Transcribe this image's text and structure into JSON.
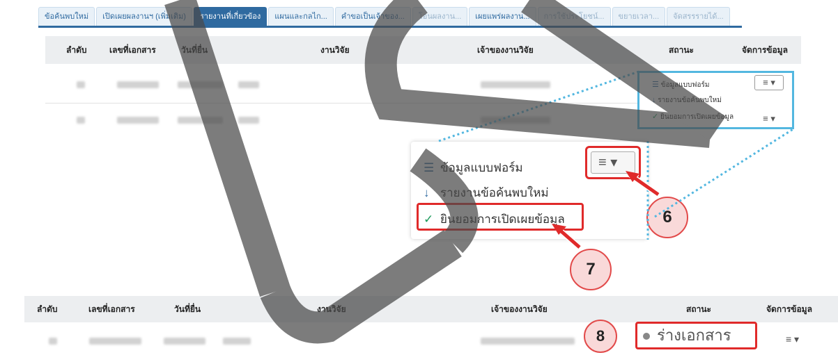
{
  "tabs": [
    {
      "label": "ข้อค้นพบใหม่",
      "state": "normal"
    },
    {
      "label": "เปิดเผยผลงานฯ (เพิ่มเติม)",
      "state": "normal"
    },
    {
      "label": "รายงานที่เกี่ยวข้อง",
      "state": "active"
    },
    {
      "label": "แผนและกลไก...",
      "state": "normal"
    },
    {
      "label": "คำขอเป็นเจ้าของ...",
      "state": "normal"
    },
    {
      "label": "โอนผลงาน...",
      "state": "dim"
    },
    {
      "label": "เผยแพร่ผลงาน...",
      "state": "normal"
    },
    {
      "label": "การใช้ประโยชน์...",
      "state": "dim"
    },
    {
      "label": "ขยายเวลา...",
      "state": "dim"
    },
    {
      "label": "จัดสรรรายได้...",
      "state": "dim"
    }
  ],
  "table": {
    "headers": {
      "order": "ลำดับ",
      "doc_no": "เลขที่เอกสาร",
      "date": "วันที่ยื่น",
      "research": "งานวิจัย",
      "owner": "เจ้าของงานวิจัย",
      "status": "สถานะ",
      "manage": "จัดการข้อมูล"
    }
  },
  "dropdown": {
    "items": [
      {
        "icon": "form-icon",
        "label": "ข้อมูลแบบฟอร์ม"
      },
      {
        "icon": "download-icon",
        "label": "รายงานข้อค้นพบใหม่"
      },
      {
        "icon": "check-icon",
        "label": "ยินยอมการเปิดเผยข้อมูล"
      }
    ],
    "menu_button_icon": "menu-icon"
  },
  "steps": {
    "six": "6",
    "seven": "7",
    "eight": "8"
  },
  "status_draft": "ร่างเอกสาร",
  "colors": {
    "accent": "#2f6aa0",
    "highlight": "#e02a2a",
    "dotted_line": "#53b7e0",
    "badge_fill": "#f9d9d9"
  }
}
